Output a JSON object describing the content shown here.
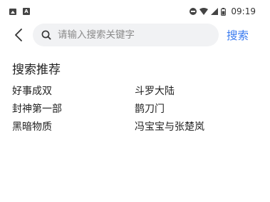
{
  "status_bar": {
    "time": "09:19",
    "left_icons": [
      "image-icon",
      "a-notification-icon"
    ],
    "right_icons": [
      "do-not-disturb-icon",
      "wifi-icon",
      "signal-icon",
      "battery-icon"
    ]
  },
  "search": {
    "placeholder": "请输入搜索关键字",
    "value": "",
    "submit_label": "搜索",
    "accent_color": "#3a7bf0"
  },
  "recommend": {
    "title": "搜索推荐",
    "items": [
      "好事成双",
      "斗罗大陆",
      "封神第一部",
      "鹊刀门",
      "黑暗物质",
      "冯宝宝与张楚岚"
    ]
  }
}
